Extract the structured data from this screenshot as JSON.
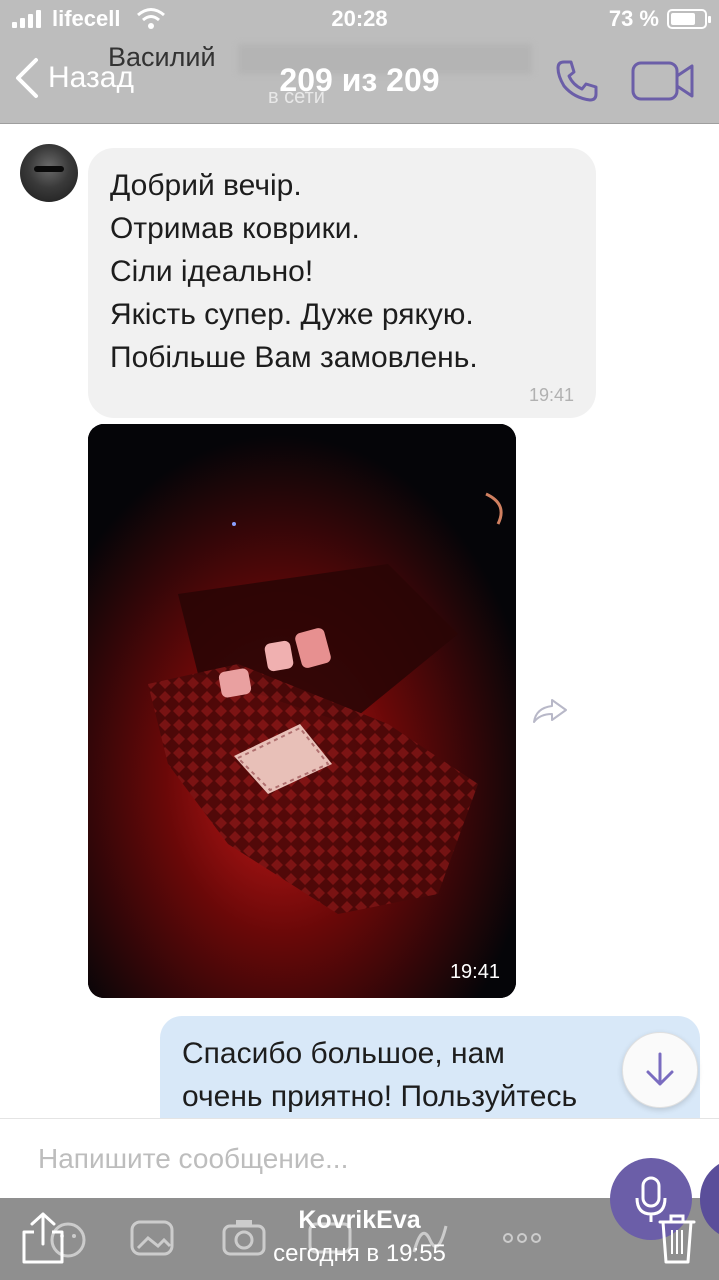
{
  "status_bar": {
    "carrier": "lifecell",
    "time": "20:28",
    "battery": "73 %"
  },
  "header": {
    "back_label": "Назад",
    "contact_name": "Василий",
    "counter": "209 из 209",
    "status": "в сети",
    "icons": [
      "phone-icon",
      "video-call-icon"
    ]
  },
  "messages": {
    "incoming_lines": [
      "Добрий вечір.",
      "Отримав коврики.",
      "Сіли ідеально!",
      "Якість супер. Дуже рякую.",
      "Побільше Вам замовлень."
    ],
    "incoming_time": "19:41",
    "photo_time": "19:41",
    "outgoing_lines": [
      "Спасибо большое, нам",
      "очень приятно! Пользуйтесь"
    ]
  },
  "input": {
    "placeholder": "Напишите сообщение..."
  },
  "share_bar": {
    "title": "KovrikEva",
    "subtitle": "сегодня в 19:55"
  },
  "colors": {
    "header_bg": "#bdbdbd",
    "accent": "#6b5ea8",
    "incoming_bubble": "#f1f1f1",
    "outgoing_bubble": "#d8e8f8"
  }
}
